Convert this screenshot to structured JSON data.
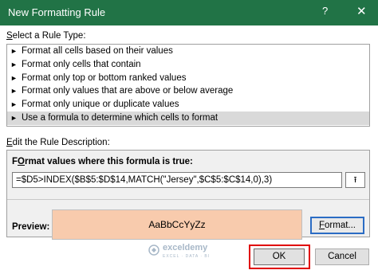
{
  "window": {
    "title": "New Formatting Rule",
    "help": "?",
    "close": "✕"
  },
  "rule_type": {
    "label_ul": "S",
    "label_rest": "elect a Rule Type:",
    "items": [
      "Format all cells based on their values",
      "Format only cells that contain",
      "Format only top or bottom ranked values",
      "Format only values that are above or below average",
      "Format only unique or duplicate values",
      "Use a formula to determine which cells to format"
    ],
    "selected_index": 5,
    "item_arrow": "►"
  },
  "description": {
    "label_ul": "E",
    "label_rest": "dit the Rule Description:",
    "formula_label_ul": "O",
    "formula_label_pre": "F",
    "formula_label_rest": "rmat values where this formula is true:",
    "formula_value": "=$D5>INDEX($B$5:$D$14,MATCH(\"Jersey\",$C$5:$C$14,0),3)",
    "ref_button": "⭱",
    "preview_label": "Preview:",
    "preview_text": "AaBbCcYyZz",
    "preview_color": "#f8cbad",
    "format_button_ul": "F",
    "format_button_rest": "ormat..."
  },
  "watermark": {
    "name": "exceldemy",
    "tagline": "EXCEL · DATA · BI"
  },
  "buttons": {
    "ok": "OK",
    "cancel": "Cancel"
  },
  "colors": {
    "titlebar": "#217346",
    "highlight": "#e00000",
    "format_focus": "#2b6cc4"
  }
}
